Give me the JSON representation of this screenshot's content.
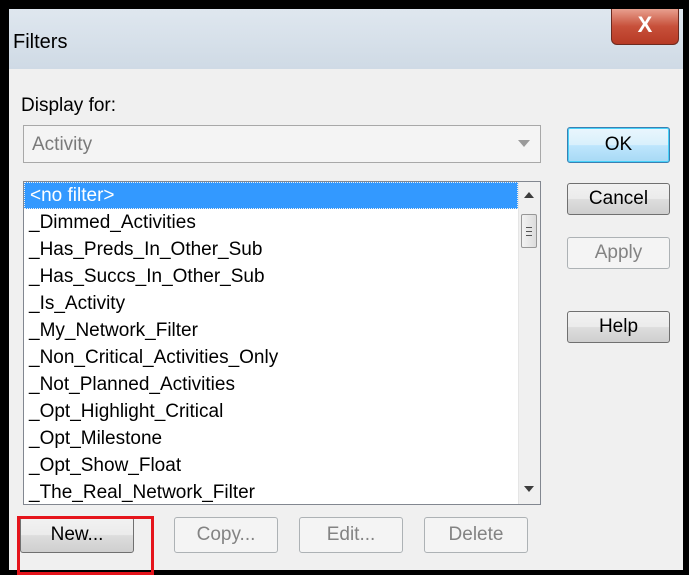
{
  "window": {
    "title": "Filters",
    "close_glyph": "X"
  },
  "display_for": {
    "label": "Display for:",
    "value": "Activity"
  },
  "filters": [
    "<no filter>",
    "_Dimmed_Activities",
    "_Has_Preds_In_Other_Sub",
    "_Has_Succs_In_Other_Sub",
    "_Is_Activity",
    "_My_Network_Filter",
    "_Non_Critical_Activities_Only",
    "_Not_Planned_Activities",
    "_Opt_Highlight_Critical",
    "_Opt_Milestone",
    "_Opt_Show_Float",
    "_The_Real_Network_Filter"
  ],
  "buttons": {
    "ok": "OK",
    "cancel": "Cancel",
    "apply": "Apply",
    "help": "Help",
    "new": "New...",
    "copy": "Copy...",
    "edit": "Edit...",
    "delete": "Delete"
  },
  "colors": {
    "selection": "#3399ff",
    "highlight": "#e5141b",
    "close_button": "#c7503a"
  }
}
